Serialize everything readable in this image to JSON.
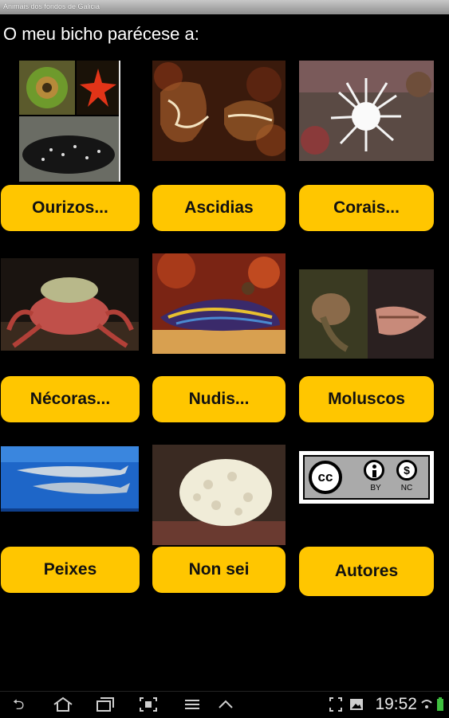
{
  "app": {
    "title": "Animais dos fondos de Galicia"
  },
  "heading": "O meu bicho parécese a:",
  "buttons": {
    "ourizos": "Ourizos...",
    "ascidias": "Ascidias",
    "corais": "Corais...",
    "necoras": "Nécoras...",
    "nudis": "Nudis...",
    "moluscos": "Moluscos",
    "peixes": "Peixes",
    "non_sei": "Non sei",
    "autores": "Autores"
  },
  "license": {
    "by": "BY",
    "nc": "NC"
  },
  "status_bar": {
    "time": "19:52"
  },
  "colors": {
    "accent": "#ffc600",
    "background": "#000000"
  }
}
